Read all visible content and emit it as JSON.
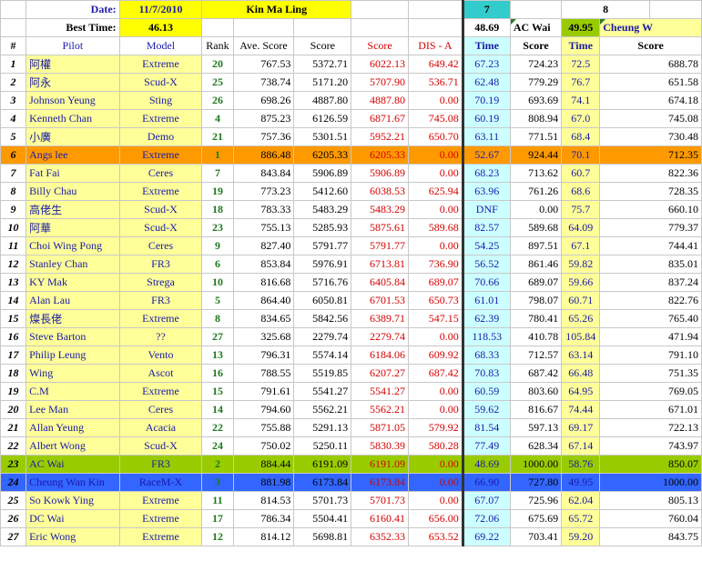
{
  "header": {
    "date_label": "Date:",
    "date_value": "11/7/2010",
    "location": "Kin Ma Ling",
    "best_time_label": "Best Time:",
    "best_time_value": "46.13",
    "round7": "7",
    "round8": "8",
    "round7_time": "48.69",
    "round7_pilot": "AC Wai",
    "round8_time": "49.95",
    "round8_pilot": "Cheung W"
  },
  "columns": {
    "num": "#",
    "pilot": "Pilot",
    "model": "Model",
    "rank": "Rank",
    "ave": "Ave. Score",
    "score": "Score",
    "score2": "Score",
    "dis": "DIS - A",
    "time7": "Time",
    "score7": "Score",
    "time8": "Time",
    "score8": "Score"
  },
  "rows": [
    {
      "n": "1",
      "pilot": "阿權",
      "model": "Extreme",
      "rank": "20",
      "ave": "767.53",
      "score": "5372.71",
      "score2": "6022.13",
      "dis": "649.42",
      "t7": "67.23",
      "s7": "724.23",
      "t8": "72.5",
      "s8": "688.78"
    },
    {
      "n": "2",
      "pilot": "阿永",
      "model": "Scud-X",
      "rank": "25",
      "ave": "738.74",
      "score": "5171.20",
      "score2": "5707.90",
      "dis": "536.71",
      "t7": "62.48",
      "s7": "779.29",
      "t8": "76.7",
      "s8": "651.58"
    },
    {
      "n": "3",
      "pilot": "Johnson Yeung",
      "model": "Sting",
      "rank": "26",
      "ave": "698.26",
      "score": "4887.80",
      "score2": "4887.80",
      "dis": "0.00",
      "t7": "70.19",
      "s7": "693.69",
      "t8": "74.1",
      "s8": "674.18"
    },
    {
      "n": "4",
      "pilot": "Kenneth Chan",
      "model": "Extreme",
      "rank": "4",
      "ave": "875.23",
      "score": "6126.59",
      "score2": "6871.67",
      "dis": "745.08",
      "t7": "60.19",
      "s7": "808.94",
      "t8": "67.0",
      "s8": "745.08"
    },
    {
      "n": "5",
      "pilot": "小廣",
      "model": "Demo",
      "rank": "21",
      "ave": "757.36",
      "score": "5301.51",
      "score2": "5952.21",
      "dis": "650.70",
      "t7": "63.11",
      "s7": "771.51",
      "t8": "68.4",
      "s8": "730.48"
    },
    {
      "n": "6",
      "pilot": "Angs lee",
      "model": "Extreme",
      "rank": "1",
      "ave": "886.48",
      "score": "6205.33",
      "score2": "6205.33",
      "dis": "0.00",
      "t7": "52.67",
      "s7": "924.44",
      "t8": "70.1",
      "s8": "712.35",
      "hl": "orange"
    },
    {
      "n": "7",
      "pilot": "Fat Fai",
      "model": "Ceres",
      "rank": "7",
      "ave": "843.84",
      "score": "5906.89",
      "score2": "5906.89",
      "dis": "0.00",
      "t7": "68.23",
      "s7": "713.62",
      "t8": "60.7",
      "s8": "822.36"
    },
    {
      "n": "8",
      "pilot": "Billy Chau",
      "model": "Extreme",
      "rank": "19",
      "ave": "773.23",
      "score": "5412.60",
      "score2": "6038.53",
      "dis": "625.94",
      "t7": "63.96",
      "s7": "761.26",
      "t8": "68.6",
      "s8": "728.35"
    },
    {
      "n": "9",
      "pilot": "高佬生",
      "model": "Scud-X",
      "rank": "18",
      "ave": "783.33",
      "score": "5483.29",
      "score2": "5483.29",
      "dis": "0.00",
      "t7": "DNF",
      "s7": "0.00",
      "t8": "75.7",
      "s8": "660.10"
    },
    {
      "n": "10",
      "pilot": "阿華",
      "model": "Scud-X",
      "rank": "23",
      "ave": "755.13",
      "score": "5285.93",
      "score2": "5875.61",
      "dis": "589.68",
      "t7": "82.57",
      "s7": "589.68",
      "t8": "64.09",
      "s8": "779.37"
    },
    {
      "n": "11",
      "pilot": "Choi Wing Pong",
      "model": "Ceres",
      "rank": "9",
      "ave": "827.40",
      "score": "5791.77",
      "score2": "5791.77",
      "dis": "0.00",
      "t7": "54.25",
      "s7": "897.51",
      "t8": "67.1",
      "s8": "744.41"
    },
    {
      "n": "12",
      "pilot": "Stanley Chan",
      "model": "FR3",
      "rank": "6",
      "ave": "853.84",
      "score": "5976.91",
      "score2": "6713.81",
      "dis": "736.90",
      "t7": "56.52",
      "s7": "861.46",
      "t8": "59.82",
      "s8": "835.01"
    },
    {
      "n": "13",
      "pilot": "KY Mak",
      "model": "Strega",
      "rank": "10",
      "ave": "816.68",
      "score": "5716.76",
      "score2": "6405.84",
      "dis": "689.07",
      "t7": "70.66",
      "s7": "689.07",
      "t8": "59.66",
      "s8": "837.24"
    },
    {
      "n": "14",
      "pilot": "Alan Lau",
      "model": "FR3",
      "rank": "5",
      "ave": "864.40",
      "score": "6050.81",
      "score2": "6701.53",
      "dis": "650.73",
      "t7": "61.01",
      "s7": "798.07",
      "t8": "60.71",
      "s8": "822.76"
    },
    {
      "n": "15",
      "pilot": "燦長佬",
      "model": "Extreme",
      "rank": "8",
      "ave": "834.65",
      "score": "5842.56",
      "score2": "6389.71",
      "dis": "547.15",
      "t7": "62.39",
      "s7": "780.41",
      "t8": "65.26",
      "s8": "765.40"
    },
    {
      "n": "16",
      "pilot": "Steve Barton",
      "model": "??",
      "rank": "27",
      "ave": "325.68",
      "score": "2279.74",
      "score2": "2279.74",
      "dis": "0.00",
      "t7": "118.53",
      "s7": "410.78",
      "t8": "105.84",
      "s8": "471.94"
    },
    {
      "n": "17",
      "pilot": "Philip Leung",
      "model": "Vento",
      "rank": "13",
      "ave": "796.31",
      "score": "5574.14",
      "score2": "6184.06",
      "dis": "609.92",
      "t7": "68.33",
      "s7": "712.57",
      "t8": "63.14",
      "s8": "791.10"
    },
    {
      "n": "18",
      "pilot": "Wing",
      "model": "Ascot",
      "rank": "16",
      "ave": "788.55",
      "score": "5519.85",
      "score2": "6207.27",
      "dis": "687.42",
      "t7": "70.83",
      "s7": "687.42",
      "t8": "66.48",
      "s8": "751.35"
    },
    {
      "n": "19",
      "pilot": "C.M",
      "model": "Extreme",
      "rank": "15",
      "ave": "791.61",
      "score": "5541.27",
      "score2": "5541.27",
      "dis": "0.00",
      "t7": "60.59",
      "s7": "803.60",
      "t8": "64.95",
      "s8": "769.05"
    },
    {
      "n": "20",
      "pilot": "Lee Man",
      "model": "Ceres",
      "rank": "14",
      "ave": "794.60",
      "score": "5562.21",
      "score2": "5562.21",
      "dis": "0.00",
      "t7": "59.62",
      "s7": "816.67",
      "t8": "74.44",
      "s8": "671.01"
    },
    {
      "n": "21",
      "pilot": "Allan Yeung",
      "model": "Acacia",
      "rank": "22",
      "ave": "755.88",
      "score": "5291.13",
      "score2": "5871.05",
      "dis": "579.92",
      "t7": "81.54",
      "s7": "597.13",
      "t8": "69.17",
      "s8": "722.13"
    },
    {
      "n": "22",
      "pilot": "Albert Wong",
      "model": "Scud-X",
      "rank": "24",
      "ave": "750.02",
      "score": "5250.11",
      "score2": "5830.39",
      "dis": "580.28",
      "t7": "77.49",
      "s7": "628.34",
      "t8": "67.14",
      "s8": "743.97"
    },
    {
      "n": "23",
      "pilot": "AC Wai",
      "model": "FR3",
      "rank": "2",
      "ave": "884.44",
      "score": "6191.09",
      "score2": "6191.09",
      "dis": "0.00",
      "t7": "48.69",
      "s7": "1000.00",
      "t8": "58.76",
      "s8": "850.07",
      "hl": "green"
    },
    {
      "n": "24",
      "pilot": "Cheung Wan Kin",
      "model": "RaceM-X",
      "rank": "3",
      "ave": "881.98",
      "score": "6173.84",
      "score2": "6173.84",
      "dis": "0.00",
      "t7": "66.90",
      "s7": "727.80",
      "t8": "49.95",
      "s8": "1000.00",
      "hl": "blue"
    },
    {
      "n": "25",
      "pilot": "So Kowk Ying",
      "model": "Extreme",
      "rank": "11",
      "ave": "814.53",
      "score": "5701.73",
      "score2": "5701.73",
      "dis": "0.00",
      "t7": "67.07",
      "s7": "725.96",
      "t8": "62.04",
      "s8": "805.13"
    },
    {
      "n": "26",
      "pilot": "DC Wai",
      "model": "Extreme",
      "rank": "17",
      "ave": "786.34",
      "score": "5504.41",
      "score2": "6160.41",
      "dis": "656.00",
      "t7": "72.06",
      "s7": "675.69",
      "t8": "65.72",
      "s8": "760.04"
    },
    {
      "n": "27",
      "pilot": "Eric Wong",
      "model": "Extreme",
      "rank": "12",
      "ave": "814.12",
      "score": "5698.81",
      "score2": "6352.33",
      "dis": "653.52",
      "t7": "69.22",
      "s7": "703.41",
      "t8": "59.20",
      "s8": "843.75"
    }
  ]
}
